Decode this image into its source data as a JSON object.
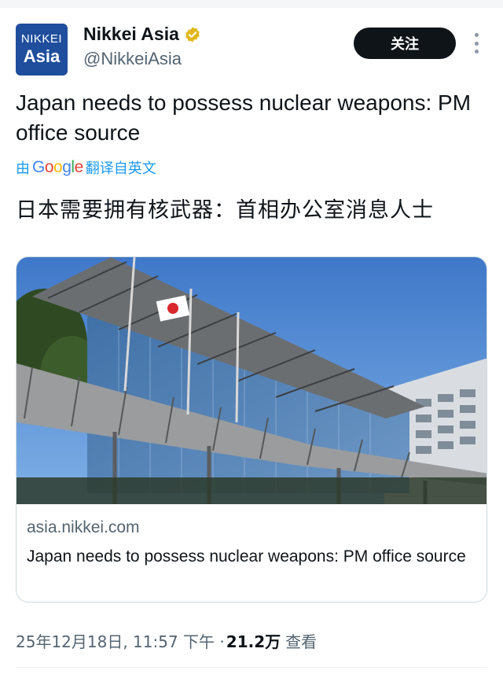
{
  "account": {
    "avatar_line1": "NIKKEI",
    "avatar_line2": "Asia",
    "display_name": "Nikkei Asia",
    "handle": "@NikkeiAsia",
    "verified": true,
    "verified_color": "#e2b719"
  },
  "actions": {
    "follow_label": "关注",
    "more_icon": "more-vertical-icon"
  },
  "tweet": {
    "text": "Japan needs to possess nuclear weapons: PM office source",
    "translate_prefix": "由",
    "translate_provider": "Google",
    "translate_suffix": "翻译自英文",
    "translated_text": "日本需要拥有核武器：首相办公室消息人士"
  },
  "link_card": {
    "image_alt": "Japanese Prime Minister's Office building with Japanese flag",
    "domain": "asia.nikkei.com",
    "title": "Japan needs to possess nuclear weapons: PM office source"
  },
  "meta": {
    "date": "25年12月18日, 11:57 下午 ·",
    "views": "21.2万",
    "views_label": "查看"
  },
  "colors": {
    "brand_blue": "#1e4e9c",
    "link_blue": "#1d9bf0",
    "follow_bg": "#0f1419"
  }
}
